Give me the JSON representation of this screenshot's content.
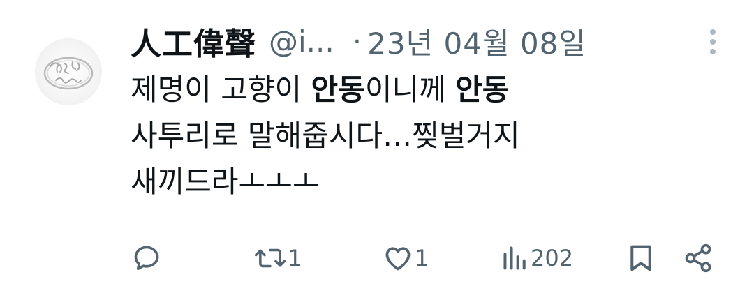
{
  "tweet": {
    "display_name": "人工偉聲",
    "handle": "@i...",
    "separator": "·",
    "date": "23년 04월 08일",
    "body": {
      "line1": {
        "t1": "제명이 고향이 ",
        "b1": "안동",
        "t2": "이니께 ",
        "b2": "안동"
      },
      "line2": "사투리로 말해줍시다…찢벌거지",
      "line3": "새끼드라ㅗㅗㅗ"
    },
    "avatar": {
      "icon": "ring-avatar",
      "engraving": "fuck you"
    },
    "more_icon": "more-vertical-icon"
  },
  "actions": {
    "reply": {
      "icon": "reply-icon",
      "count": ""
    },
    "retweet": {
      "icon": "retweet-icon",
      "count": "1"
    },
    "like": {
      "icon": "heart-icon",
      "count": "1"
    },
    "views": {
      "icon": "views-icon",
      "count": "202"
    },
    "bookmark": {
      "icon": "bookmark-icon"
    },
    "share": {
      "icon": "share-icon"
    }
  },
  "colors": {
    "text_primary": "#0f1419",
    "text_secondary": "#536471",
    "more_dots": "#aab8c2"
  }
}
